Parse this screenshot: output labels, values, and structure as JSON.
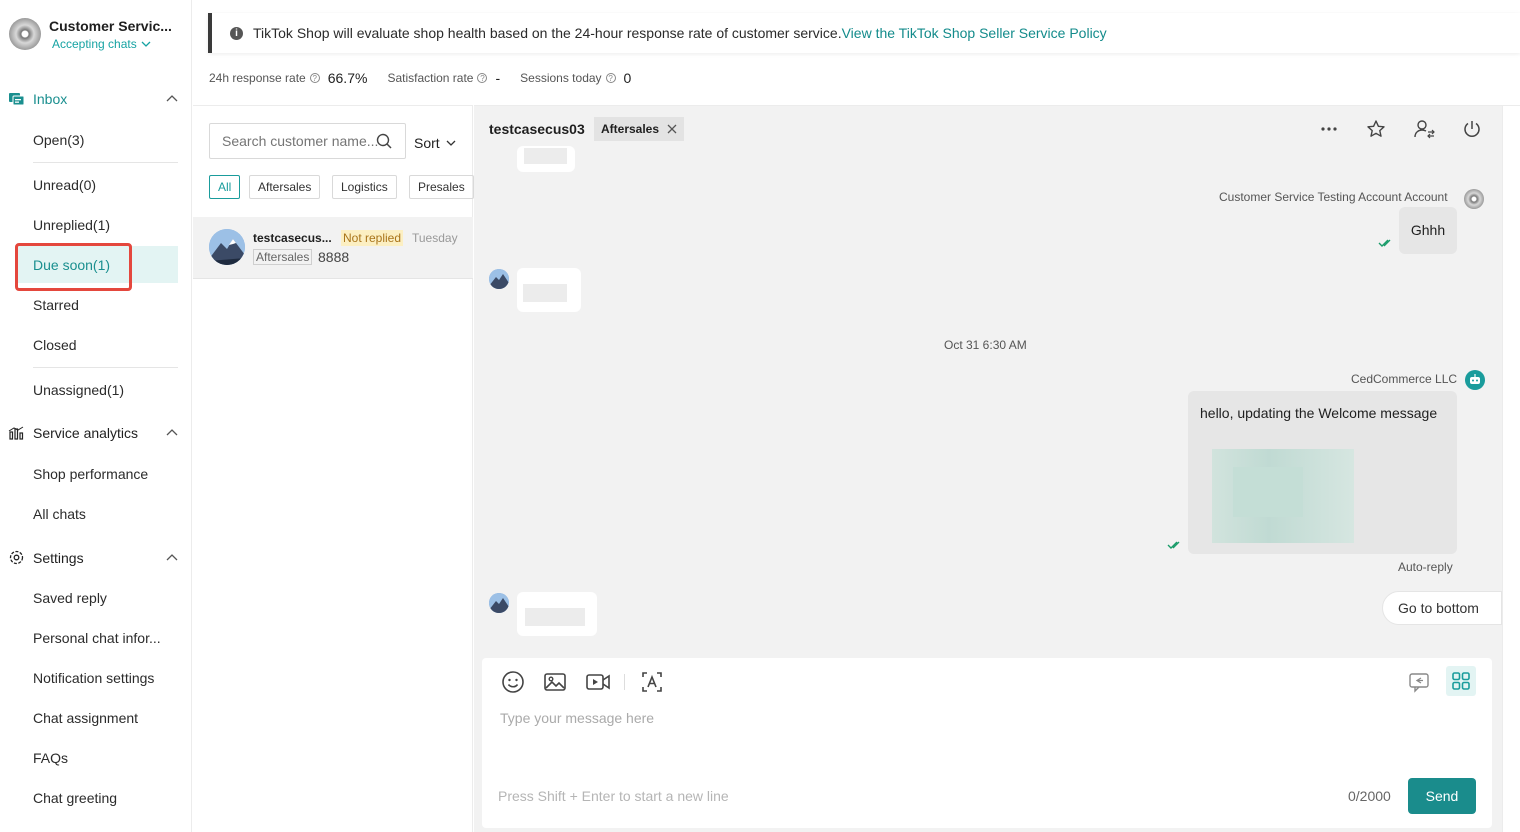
{
  "agent": {
    "name": "Customer Servic...",
    "status": "Accepting chats"
  },
  "nav": {
    "inbox": "Inbox",
    "open": "Open(3)",
    "unread": "Unread(0)",
    "unreplied": "Unreplied(1)",
    "due_soon": "Due soon(1)",
    "starred": "Starred",
    "closed": "Closed",
    "unassigned": "Unassigned(1)",
    "service_analytics": "Service analytics",
    "shop_performance": "Shop performance",
    "all_chats": "All chats",
    "settings": "Settings",
    "saved_reply": "Saved reply",
    "personal_chat_info": "Personal chat infor...",
    "notification_settings": "Notification settings",
    "chat_assignment": "Chat assignment",
    "faqs": "FAQs",
    "chat_greeting": "Chat greeting"
  },
  "banner": {
    "text": "TikTok Shop will evaluate shop health based on the 24-hour response rate of customer service.",
    "link": "View the TikTok Shop Seller Service Policy"
  },
  "stats": {
    "response_label": "24h response rate",
    "response_value": "66.7%",
    "satisfaction_label": "Satisfaction rate",
    "satisfaction_value": "-",
    "sessions_label": "Sessions today",
    "sessions_value": "0"
  },
  "chatlist": {
    "search_placeholder": "Search customer name...",
    "sort_label": "Sort",
    "filters": [
      "All",
      "Aftersales",
      "Logistics",
      "Presales"
    ],
    "conversations": [
      {
        "name": "testcasecus...",
        "status": "Not replied",
        "time": "Tuesday",
        "tag": "Aftersales",
        "last": "8888"
      }
    ]
  },
  "chat": {
    "customer": "testcasecus03",
    "tag": "Aftersales",
    "messages": {
      "sender1": "Customer Service Testing Account Account",
      "msg1": "Ghhh",
      "date": "Oct 31 6:30 AM",
      "sender2": "CedCommerce LLC",
      "msg2": "hello, updating the Welcome message",
      "auto_reply": "Auto-reply"
    },
    "go_bottom": "Go to bottom",
    "composer": {
      "placeholder": "Type your message here",
      "hint": "Press Shift + Enter to start a new line",
      "counter": "0/2000",
      "send": "Send"
    }
  },
  "colors": {
    "accent": "#1a8c8c",
    "highlight": "#e4473d",
    "notice_bg": "#fcefc2"
  }
}
